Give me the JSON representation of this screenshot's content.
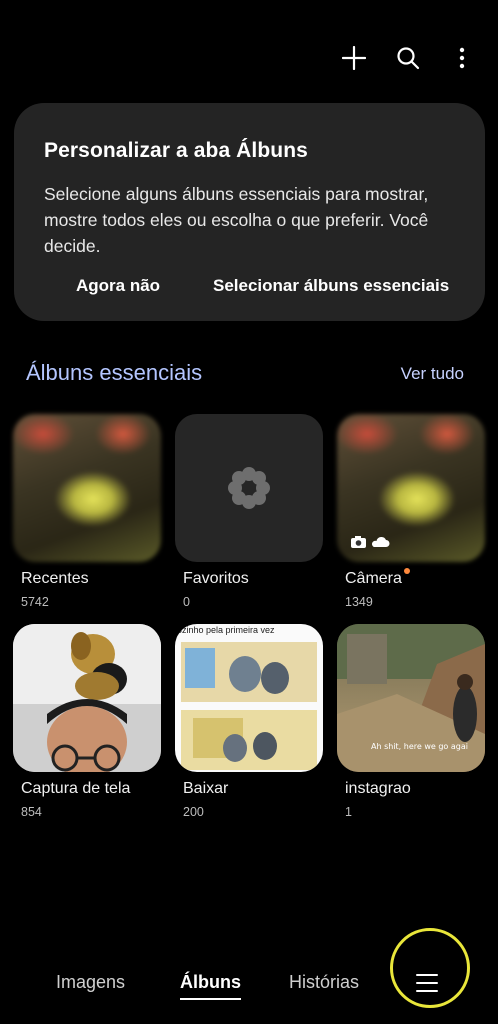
{
  "toolbar": {
    "add_icon": "plus-icon",
    "search_icon": "search-icon",
    "more_icon": "more-vertical-icon"
  },
  "card": {
    "title": "Personalizar a aba Álbuns",
    "body": "Selecione alguns álbuns essenciais para mostrar, mostre todos eles ou escolha o que preferir. Você decide.",
    "dismiss_label": "Agora não",
    "select_label": "Selecionar álbuns essenciais"
  },
  "section": {
    "title": "Álbuns essenciais",
    "see_all": "Ver tudo"
  },
  "albums": [
    {
      "name": "Recentes",
      "count": "5742"
    },
    {
      "name": "Favoritos",
      "count": "0"
    },
    {
      "name": "Câmera",
      "count": "1349",
      "badges": [
        "camera-icon",
        "cloud-icon"
      ]
    },
    {
      "name": "Captura de tela",
      "count": "854"
    },
    {
      "name": "Baixar",
      "count": "200",
      "thumb_caption": "ozinho pela primeira vez"
    },
    {
      "name": "instagrao",
      "count": "1",
      "thumb_caption": "Ah shit, here we go agai"
    }
  ],
  "bottom_nav": {
    "items": [
      {
        "label": "Imagens"
      },
      {
        "label": "Álbuns",
        "active": true
      },
      {
        "label": "Histórias"
      }
    ],
    "menu_icon": "hamburger-menu-icon",
    "highlight_color": "#e9e63a"
  },
  "colors": {
    "accent": "#b4c6ff",
    "card_bg": "#242424",
    "notification_dot": "#ff8a3d"
  }
}
